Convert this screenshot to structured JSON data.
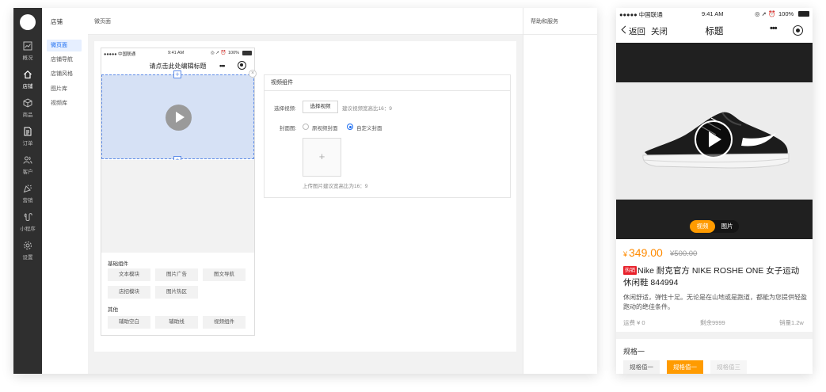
{
  "sidebar": {
    "items": [
      {
        "label": "概况",
        "icon": "chart-icon"
      },
      {
        "label": "店铺",
        "icon": "home-icon"
      },
      {
        "label": "商品",
        "icon": "box-icon"
      },
      {
        "label": "订单",
        "icon": "document-icon"
      },
      {
        "label": "客户",
        "icon": "users-icon"
      },
      {
        "label": "营销",
        "icon": "megaphone-icon"
      },
      {
        "label": "小程序",
        "icon": "mini-program-icon"
      },
      {
        "label": "设置",
        "icon": "gear-icon"
      }
    ]
  },
  "subnav": {
    "title": "店铺",
    "items": [
      "微页面",
      "店铺导航",
      "店铺风格",
      "图片库",
      "视频库"
    ]
  },
  "topbar": {
    "title": "微页面"
  },
  "help": {
    "title": "帮助和服务"
  },
  "editor": {
    "status": {
      "carrier": "●●●●● 中国联通",
      "time": "9:41 AM",
      "battery": "100%"
    },
    "nav_title": "请点击此处编辑标题",
    "nav_dots": "•••",
    "basic_title": "基础组件",
    "basic": [
      "文本模块",
      "图片广告",
      "图文导航",
      "店招模块",
      "图片热区"
    ],
    "other_title": "其他",
    "other": [
      "辅助空白",
      "辅助线",
      "视频组件"
    ]
  },
  "video_settings": {
    "header": "视频组件",
    "select_label": "选择视频:",
    "select_button": "选择视频",
    "select_hint": "建议视频宽高比16：9",
    "cover_label": "封面图:",
    "cover_options": [
      "原视频封面",
      "自定义封面"
    ],
    "cover_selected": 1,
    "upload_icon": "+",
    "upload_hint": "上传图片建议宽高比为16：9"
  },
  "mobile": {
    "status": {
      "carrier": "●●●●● 中国联通",
      "time": "9:41 AM",
      "battery": "100%"
    },
    "nav": {
      "back": "返回",
      "close": "关闭",
      "title": "标题",
      "dots": "•••"
    },
    "media_tabs": [
      "视频",
      "图片"
    ],
    "media_tab_selected": 0,
    "price_currency": "¥",
    "price": "349.00",
    "price_original": "¥500.00",
    "tag": "热销",
    "product_name": "Nike 耐克官方 NIKE ROSHE ONE 女子运动休闲鞋 844994",
    "description": "休闲舒适，弹性十足。无论是在山地或是跑道，都能为您提供轻盈跑动的绝佳条件。",
    "shipping": "运费 ¥ 0",
    "stock": "剩余9999",
    "sales": "销量1.2w",
    "spec_title": "规格一",
    "spec_options": [
      "规格值一",
      "规格值一",
      "规格值三"
    ],
    "spec_selected": 1,
    "spec_disabled": 2
  },
  "colors": {
    "accent": "#1a6cf2",
    "price": "#ff8a00",
    "tag": "#e8212b",
    "selected_spec": "#ff9b00"
  }
}
